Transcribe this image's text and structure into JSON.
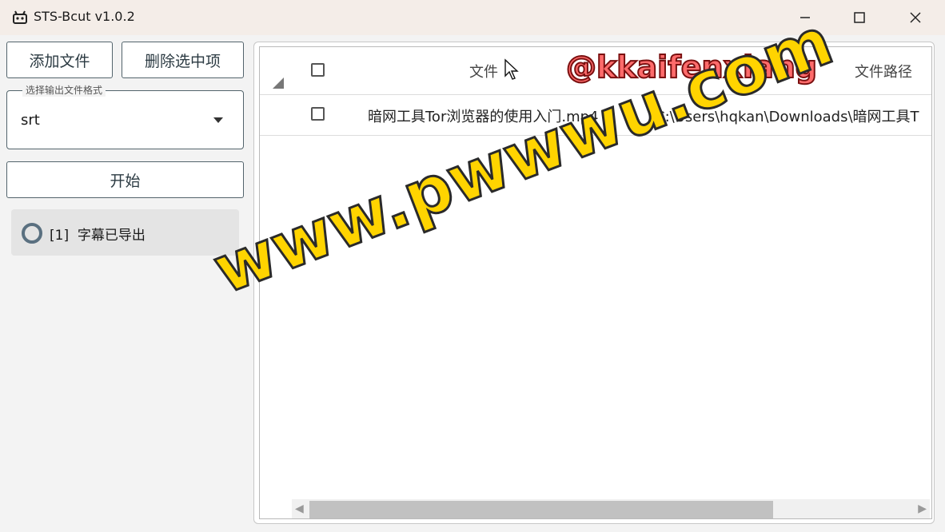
{
  "window": {
    "title": "STS-Bcut v1.0.2",
    "icon": "robot-app-icon",
    "controls": [
      "minimize-icon",
      "maximize-icon",
      "close-icon"
    ]
  },
  "sidebar": {
    "add_button": "添加文件",
    "delete_button": "删除选中项",
    "format_label": "选择输出文件格式",
    "format_value": "srt",
    "start_button": "开始",
    "status": {
      "index": "[1]",
      "text": "字幕已导出"
    }
  },
  "table": {
    "columns": [
      "文件名",
      "文件路径"
    ],
    "header_col1_visible": "文件",
    "rows": [
      {
        "name": "暗网工具Tor浏览器的使用入门.mp4",
        "path": "C:\\Users\\hqkan\\Downloads\\暗网工具T"
      }
    ]
  },
  "watermarks": {
    "top": "@kkaifenxiang",
    "center": "www.pwwwu.com"
  },
  "colors": {
    "titlebar": "#f4ede8",
    "border": "#53646c",
    "status_bg": "#e4e4e4",
    "watermark_top": "#ff6b6b",
    "watermark_center": "#ffd400"
  }
}
